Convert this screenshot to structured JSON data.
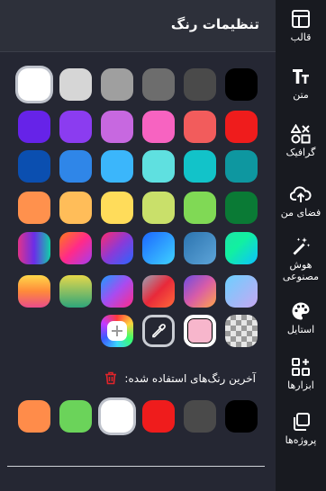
{
  "panel": {
    "title": "تنظیمات رنگ",
    "recent_label": "آخرین رنگ‌های استفاده شده:"
  },
  "sidebar": {
    "items": [
      {
        "label": "قالب",
        "icon": "template-icon"
      },
      {
        "label": "متن",
        "icon": "text-icon"
      },
      {
        "label": "گرافیک",
        "icon": "shapes-icon"
      },
      {
        "label": "فضای من",
        "icon": "cloud-upload-icon"
      },
      {
        "label": "هوش مصنوعی",
        "icon": "magic-wand-icon"
      },
      {
        "label": "استایل",
        "icon": "palette-icon"
      },
      {
        "label": "ابزارها",
        "icon": "tools-grid-icon"
      },
      {
        "label": "پروژه‌ها",
        "icon": "projects-icon"
      }
    ]
  },
  "palette": {
    "rows": [
      [
        "#000000",
        "#4a4a4a",
        "#6d6d6d",
        "#9f9f9f",
        "#d6d6d6",
        "#ffffff"
      ],
      [
        "#ef1c1c",
        "#f25c5c",
        "#f763c1",
        "#c768e0",
        "#8b3cf0",
        "#6623e8"
      ],
      [
        "#0e97a0",
        "#12c3c9",
        "#5fe0e0",
        "#3bb6fb",
        "#2f86e8",
        "#0b4fb0"
      ],
      [
        "#0a7a35",
        "#80d955",
        "#c9e06a",
        "#ffdc5a",
        "#ffbd59",
        "#ff914d"
      ],
      [
        "linear-gradient(135deg,#1ee3a8,#12f0a0 40%,#0cc2ff)",
        "linear-gradient(135deg,#2c74b0,#5da4d8)",
        "linear-gradient(135deg,#1c67ff,#3fd2ff)",
        "linear-gradient(135deg,#ff2a6d,#8a3ad8,#2a66ff)",
        "linear-gradient(135deg,#ff7a1a,#ff2a8a,#a43cf0)",
        "linear-gradient(90deg,#e0338b,#6a2ee8,#11d0a8)"
      ],
      [
        "linear-gradient(135deg,#6bd0ff,#c7a8f2)",
        "linear-gradient(135deg,#6d4ce0,#d85ca8,#ffa54a)",
        "linear-gradient(135deg,#9aa3b5,#e8293a 50%,#ff6a3a)",
        "linear-gradient(135deg,#1c9cff,#a84cf0,#ff2a8a)",
        "linear-gradient(180deg,#e5d84a,#2ea57a)",
        "linear-gradient(180deg,#ffd84a,#ff8a3a,#e84c8a)"
      ]
    ],
    "special": [
      {
        "name": "transparent-swatch",
        "kind": "checker"
      },
      {
        "name": "light-pink-swatch",
        "kind": "pink",
        "color": "#f7b6cc"
      },
      {
        "name": "eyedropper-button",
        "kind": "dropper"
      },
      {
        "name": "add-color-button",
        "kind": "add"
      }
    ],
    "recent": [
      "#000000",
      "#4a4a4a",
      "#ef1c1c",
      "#ffffff",
      "#6bd35a",
      "#ff8c4a"
    ]
  }
}
